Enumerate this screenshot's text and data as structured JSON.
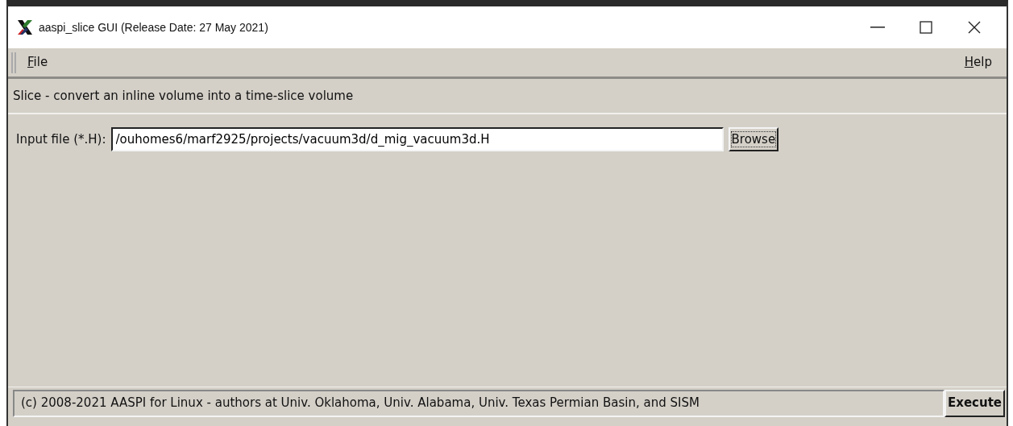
{
  "window": {
    "title": "aaspi_slice GUI (Release Date: 27 May 2021)"
  },
  "menu": [
    {
      "label": "File"
    },
    {
      "label": "Help"
    }
  ],
  "heading": "Slice - convert an inline volume into a time-slice volume",
  "input_file": {
    "label": "Input file (*.H):",
    "value": "/ouhomes6/marf2925/projects/vacuum3d/d_mig_vacuum3d.H",
    "button": "Browse"
  },
  "status_bar": {
    "text": "(c) 2008-2021 AASPI for Linux - authors at Univ. Oklahoma, Univ. Alabama, Univ. Texas Permian Basin, and SISM",
    "button": "Execute"
  }
}
